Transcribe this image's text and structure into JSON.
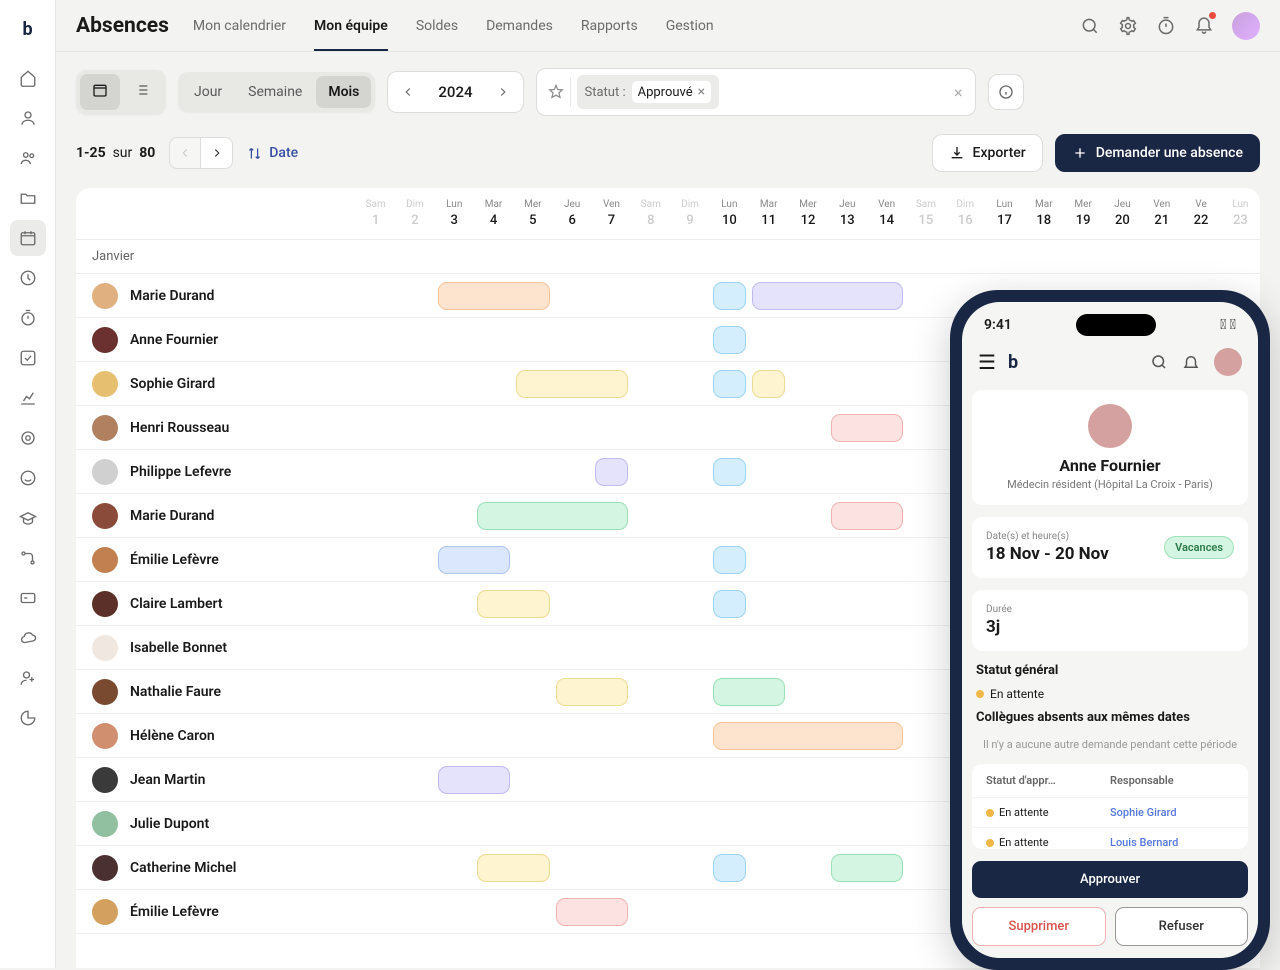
{
  "title": "Absences",
  "tabs": [
    "Mon calendrier",
    "Mon équipe",
    "Soldes",
    "Demandes",
    "Rapports",
    "Gestion"
  ],
  "activeTab": 1,
  "view": {
    "options": [
      "Jour",
      "Semaine",
      "Mois"
    ],
    "active": 2
  },
  "year": "2024",
  "filter": {
    "label": "Statut :",
    "value": "Approuvé"
  },
  "count": {
    "range": "1-25",
    "of_word": "sur",
    "total": "80"
  },
  "sort": "Date",
  "export": "Exporter",
  "request": "Demander une absence",
  "month": "Janvier",
  "days": [
    {
      "w": "Sam",
      "n": "1",
      "we": true
    },
    {
      "w": "Dim",
      "n": "2",
      "we": true
    },
    {
      "w": "Lun",
      "n": "3"
    },
    {
      "w": "Mar",
      "n": "4"
    },
    {
      "w": "Mer",
      "n": "5"
    },
    {
      "w": "Jeu",
      "n": "6"
    },
    {
      "w": "Ven",
      "n": "7"
    },
    {
      "w": "Sam",
      "n": "8",
      "we": true
    },
    {
      "w": "Dim",
      "n": "9",
      "we": true
    },
    {
      "w": "Lun",
      "n": "10"
    },
    {
      "w": "Mar",
      "n": "11"
    },
    {
      "w": "Mer",
      "n": "12"
    },
    {
      "w": "Jeu",
      "n": "13"
    },
    {
      "w": "Ven",
      "n": "14"
    },
    {
      "w": "Sam",
      "n": "15",
      "we": true
    },
    {
      "w": "Dim",
      "n": "16",
      "we": true
    },
    {
      "w": "Lun",
      "n": "17"
    },
    {
      "w": "Mar",
      "n": "18"
    },
    {
      "w": "Mer",
      "n": "19"
    },
    {
      "w": "Jeu",
      "n": "20"
    },
    {
      "w": "Ven",
      "n": "21"
    },
    {
      "w": "Ve",
      "n": "22"
    },
    {
      "w": "Lun",
      "n": "23",
      "we": true
    }
  ],
  "rows": [
    {
      "name": "Marie Durand",
      "av": "#e0b080",
      "bars": [
        {
          "s": 3,
          "e": 5,
          "c": "c1"
        },
        {
          "s": 10,
          "e": 10,
          "c": "c2"
        },
        {
          "s": 11,
          "e": 14,
          "c": "c3"
        }
      ]
    },
    {
      "name": "Anne Fournier",
      "av": "#6b3030",
      "bars": [
        {
          "s": 10,
          "e": 10,
          "c": "c2"
        }
      ]
    },
    {
      "name": "Sophie Girard",
      "av": "#e6c070",
      "bars": [
        {
          "s": 5,
          "e": 7,
          "c": "c4"
        },
        {
          "s": 10,
          "e": 10,
          "c": "c2"
        },
        {
          "s": 11,
          "e": 11,
          "c": "c4"
        }
      ]
    },
    {
      "name": "Henri Rousseau",
      "av": "#b08060",
      "bars": [
        {
          "s": 13,
          "e": 14,
          "c": "c5"
        }
      ]
    },
    {
      "name": "Philippe Lefevre",
      "av": "#d0d0d0",
      "bars": [
        {
          "s": 7,
          "e": 7,
          "c": "c3"
        },
        {
          "s": 10,
          "e": 10,
          "c": "c2"
        }
      ]
    },
    {
      "name": "Marie Durand",
      "av": "#8b4b3b",
      "bars": [
        {
          "s": 4,
          "e": 7,
          "c": "c6"
        },
        {
          "s": 13,
          "e": 14,
          "c": "c5"
        }
      ]
    },
    {
      "name": "Émilie Lefèvre",
      "av": "#c28050",
      "bars": [
        {
          "s": 3,
          "e": 4,
          "c": "c7"
        },
        {
          "s": 10,
          "e": 10,
          "c": "c2"
        }
      ]
    },
    {
      "name": "Claire Lambert",
      "av": "#5b3028",
      "bars": [
        {
          "s": 4,
          "e": 5,
          "c": "c4"
        },
        {
          "s": 10,
          "e": 10,
          "c": "c2"
        }
      ]
    },
    {
      "name": "Isabelle Bonnet",
      "av": "#f0e8e0",
      "bars": []
    },
    {
      "name": "Nathalie Faure",
      "av": "#7a4a30",
      "bars": [
        {
          "s": 6,
          "e": 7,
          "c": "c4"
        },
        {
          "s": 10,
          "e": 11,
          "c": "c6"
        }
      ]
    },
    {
      "name": "Hélène Caron",
      "av": "#d09070",
      "bars": [
        {
          "s": 10,
          "e": 14,
          "c": "c1"
        }
      ]
    },
    {
      "name": "Jean Martin",
      "av": "#3a3a3a",
      "bars": [
        {
          "s": 3,
          "e": 4,
          "c": "c3"
        }
      ]
    },
    {
      "name": "Julie Dupont",
      "av": "#90c0a0",
      "bars": []
    },
    {
      "name": "Catherine Michel",
      "av": "#4a3030",
      "bars": [
        {
          "s": 4,
          "e": 5,
          "c": "c4"
        },
        {
          "s": 10,
          "e": 10,
          "c": "c2"
        },
        {
          "s": 13,
          "e": 14,
          "c": "c6"
        }
      ]
    },
    {
      "name": "Émilie Lefèvre",
      "av": "#d4a060",
      "bars": [
        {
          "s": 6,
          "e": 7,
          "c": "c5"
        }
      ]
    }
  ],
  "phone": {
    "time": "9:41",
    "name": "Anne Fournier",
    "role": "Médecin résident (Hôpital La Croix - Paris)",
    "dates_lbl": "Date(s) et heure(s)",
    "dates": "18 Nov - 20 Nov",
    "tag": "Vacances",
    "dur_lbl": "Durée",
    "dur": "3j",
    "status_t": "Statut général",
    "status_v": "En attente",
    "colleagues_t": "Collègues absents aux mêmes dates",
    "colleagues_note": "Il n'y a aucune autre demande pendant cette période",
    "tbl_h1": "Statut d'appr…",
    "tbl_h2": "Responsable",
    "tbl": [
      {
        "st": "En attente",
        "resp": "Sophie Girard"
      },
      {
        "st": "En attente",
        "resp": "Louis Bernard"
      }
    ],
    "approve": "Approuver",
    "delete": "Supprimer",
    "refuse": "Refuser"
  }
}
